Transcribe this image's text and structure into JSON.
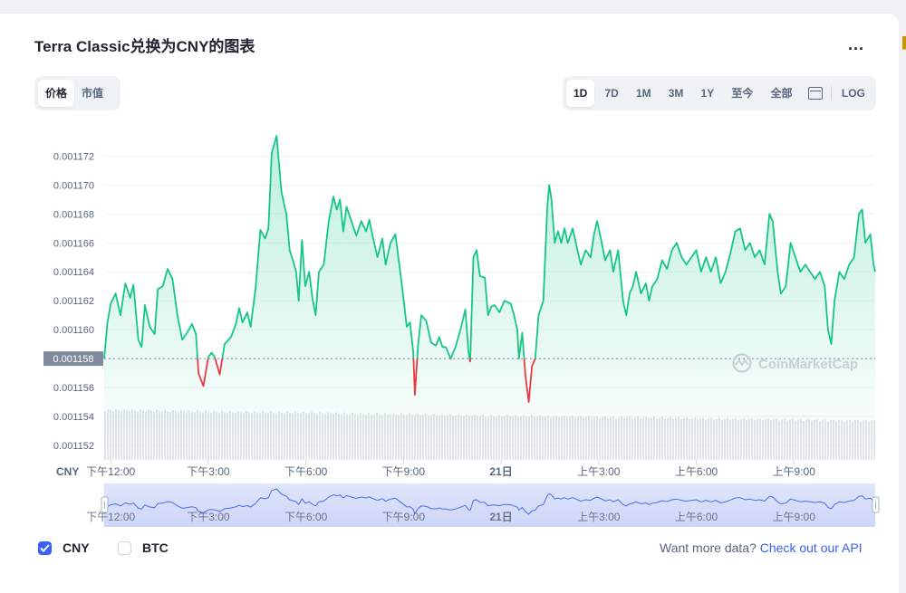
{
  "header": {
    "title": "Terra Classic兑换为CNY的图表",
    "more": "..."
  },
  "view_tabs": [
    {
      "label": "价格",
      "active": true
    },
    {
      "label": "市值",
      "active": false
    }
  ],
  "range_tabs": [
    {
      "label": "1D",
      "active": true
    },
    {
      "label": "7D"
    },
    {
      "label": "1M"
    },
    {
      "label": "3M"
    },
    {
      "label": "1Y"
    },
    {
      "label": "至今"
    },
    {
      "label": "全部"
    }
  ],
  "log_label": "LOG",
  "colors": {
    "up": "#16c784",
    "down": "#ea3943",
    "accent": "#3861fb",
    "volume": "#e6e7ea",
    "navigator": "#e8ecfb"
  },
  "watermark": "CoinMarketCap",
  "legend": [
    {
      "label": "CNY",
      "checked": true
    },
    {
      "label": "BTC",
      "checked": false
    }
  ],
  "footer": {
    "text": "Want more data?",
    "link": "Check out our API"
  },
  "chart_data": {
    "type": "area",
    "currency_label": "CNY",
    "y_ticks": [
      0.001152,
      0.001154,
      0.001156,
      0.001158,
      0.00116,
      0.001162,
      0.001164,
      0.001166,
      0.001168,
      0.00117,
      0.001172
    ],
    "ylim": [
      0.001151,
      0.0011734
    ],
    "reference_value": 0.001158,
    "reference_label": "0.001158",
    "x_ticks": [
      "下午12:00",
      "下午3:00",
      "下午6:00",
      "下午9:00",
      "21日",
      "上午3:00",
      "上午6:00",
      "上午9:00"
    ],
    "x_tick_hours": [
      12,
      15,
      18,
      21,
      24,
      27,
      30,
      33
    ],
    "xlim": [
      11.8,
      35.5
    ],
    "grid": true,
    "series": [
      {
        "values": [
          [
            11.8,
            0.001158
          ],
          [
            11.9,
            0.0011605
          ],
          [
            12.0,
            0.0011618
          ],
          [
            12.15,
            0.0011625
          ],
          [
            12.3,
            0.001161
          ],
          [
            12.45,
            0.0011632
          ],
          [
            12.6,
            0.0011622
          ],
          [
            12.7,
            0.0011631
          ],
          [
            12.85,
            0.0011593
          ],
          [
            12.95,
            0.0011588
          ],
          [
            13.05,
            0.0011617
          ],
          [
            13.2,
            0.0011602
          ],
          [
            13.35,
            0.0011597
          ],
          [
            13.45,
            0.0011628
          ],
          [
            13.6,
            0.001163
          ],
          [
            13.75,
            0.0011642
          ],
          [
            13.9,
            0.0011635
          ],
          [
            14.05,
            0.001161
          ],
          [
            14.2,
            0.0011593
          ],
          [
            14.35,
            0.0011598
          ],
          [
            14.5,
            0.0011604
          ],
          [
            14.62,
            0.0011597
          ],
          [
            14.7,
            0.001157
          ],
          [
            14.85,
            0.0011561
          ],
          [
            15.0,
            0.0011581
          ],
          [
            15.1,
            0.0011584
          ],
          [
            15.2,
            0.0011581
          ],
          [
            15.35,
            0.0011569
          ],
          [
            15.5,
            0.001159
          ],
          [
            15.7,
            0.0011595
          ],
          [
            15.85,
            0.0011604
          ],
          [
            15.95,
            0.0011615
          ],
          [
            16.05,
            0.0011605
          ],
          [
            16.2,
            0.0011612
          ],
          [
            16.3,
            0.0011602
          ],
          [
            16.45,
            0.0011628
          ],
          [
            16.6,
            0.0011669
          ],
          [
            16.75,
            0.0011663
          ],
          [
            16.85,
            0.001167
          ],
          [
            16.95,
            0.0011722
          ],
          [
            17.1,
            0.0011734
          ],
          [
            17.25,
            0.0011695
          ],
          [
            17.4,
            0.001168
          ],
          [
            17.5,
            0.0011655
          ],
          [
            17.6,
            0.0011648
          ],
          [
            17.7,
            0.001164
          ],
          [
            17.78,
            0.001162
          ],
          [
            17.88,
            0.0011662
          ],
          [
            17.98,
            0.001163
          ],
          [
            18.1,
            0.001164
          ],
          [
            18.2,
            0.0011622
          ],
          [
            18.3,
            0.001161
          ],
          [
            18.4,
            0.001164
          ],
          [
            18.55,
            0.0011645
          ],
          [
            18.7,
            0.0011675
          ],
          [
            18.85,
            0.0011692
          ],
          [
            18.95,
            0.0011683
          ],
          [
            19.05,
            0.001169
          ],
          [
            19.15,
            0.0011668
          ],
          [
            19.25,
            0.0011685
          ],
          [
            19.4,
            0.0011675
          ],
          [
            19.55,
            0.0011665
          ],
          [
            19.7,
            0.0011675
          ],
          [
            19.85,
            0.0011668
          ],
          [
            19.95,
            0.0011676
          ],
          [
            20.05,
            0.0011665
          ],
          [
            20.2,
            0.001165
          ],
          [
            20.35,
            0.0011663
          ],
          [
            20.45,
            0.0011645
          ],
          [
            20.6,
            0.001166
          ],
          [
            20.75,
            0.0011666
          ],
          [
            20.9,
            0.001164
          ],
          [
            21.0,
            0.0011622
          ],
          [
            21.1,
            0.0011602
          ],
          [
            21.2,
            0.0011605
          ],
          [
            21.3,
            0.0011585
          ],
          [
            21.35,
            0.0011555
          ],
          [
            21.45,
            0.001159
          ],
          [
            21.55,
            0.001161
          ],
          [
            21.7,
            0.0011606
          ],
          [
            21.85,
            0.0011591
          ],
          [
            22.0,
            0.0011589
          ],
          [
            22.1,
            0.0011595
          ],
          [
            22.2,
            0.0011588
          ],
          [
            22.3,
            0.0011588
          ],
          [
            22.45,
            0.001158
          ],
          [
            22.6,
            0.0011588
          ],
          [
            22.75,
            0.00116
          ],
          [
            22.9,
            0.0011614
          ],
          [
            23.0,
            0.0011584
          ],
          [
            23.05,
            0.0011578
          ],
          [
            23.15,
            0.001165
          ],
          [
            23.25,
            0.0011655
          ],
          [
            23.35,
            0.0011637
          ],
          [
            23.5,
            0.0011636
          ],
          [
            23.6,
            0.001161
          ],
          [
            23.7,
            0.0011616
          ],
          [
            23.8,
            0.0011617
          ],
          [
            23.95,
            0.0011612
          ],
          [
            24.1,
            0.001162
          ],
          [
            24.3,
            0.0011618
          ],
          [
            24.4,
            0.001161
          ],
          [
            24.5,
            0.00116
          ],
          [
            24.55,
            0.001158
          ],
          [
            24.65,
            0.0011598
          ],
          [
            24.75,
            0.0011568
          ],
          [
            24.85,
            0.001155
          ],
          [
            24.95,
            0.0011575
          ],
          [
            25.05,
            0.001158
          ],
          [
            25.15,
            0.001161
          ],
          [
            25.3,
            0.001162
          ],
          [
            25.42,
            0.0011685
          ],
          [
            25.48,
            0.00117
          ],
          [
            25.55,
            0.001169
          ],
          [
            25.65,
            0.001166
          ],
          [
            25.75,
            0.0011668
          ],
          [
            25.85,
            0.001166
          ],
          [
            25.95,
            0.001167
          ],
          [
            26.05,
            0.001166
          ],
          [
            26.2,
            0.001167
          ],
          [
            26.35,
            0.0011655
          ],
          [
            26.45,
            0.0011645
          ],
          [
            26.6,
            0.0011655
          ],
          [
            26.75,
            0.001165
          ],
          [
            26.85,
            0.0011665
          ],
          [
            26.95,
            0.0011675
          ],
          [
            27.05,
            0.0011665
          ],
          [
            27.2,
            0.0011648
          ],
          [
            27.35,
            0.0011655
          ],
          [
            27.45,
            0.001164
          ],
          [
            27.6,
            0.0011655
          ],
          [
            27.75,
            0.001162
          ],
          [
            27.85,
            0.001161
          ],
          [
            27.95,
            0.0011625
          ],
          [
            28.05,
            0.001163
          ],
          [
            28.15,
            0.001164
          ],
          [
            28.3,
            0.0011625
          ],
          [
            28.45,
            0.0011632
          ],
          [
            28.55,
            0.001162
          ],
          [
            28.65,
            0.001163
          ],
          [
            28.8,
            0.0011635
          ],
          [
            28.95,
            0.0011648
          ],
          [
            29.1,
            0.0011642
          ],
          [
            29.25,
            0.0011655
          ],
          [
            29.4,
            0.001166
          ],
          [
            29.55,
            0.001165
          ],
          [
            29.7,
            0.0011645
          ],
          [
            29.85,
            0.001165
          ],
          [
            30.0,
            0.0011655
          ],
          [
            30.15,
            0.001164
          ],
          [
            30.3,
            0.001165
          ],
          [
            30.45,
            0.001164
          ],
          [
            30.6,
            0.001165
          ],
          [
            30.75,
            0.0011632
          ],
          [
            30.9,
            0.001164
          ],
          [
            31.05,
            0.0011653
          ],
          [
            31.2,
            0.0011668
          ],
          [
            31.35,
            0.001167
          ],
          [
            31.5,
            0.0011655
          ],
          [
            31.65,
            0.001166
          ],
          [
            31.8,
            0.001165
          ],
          [
            31.95,
            0.0011655
          ],
          [
            32.1,
            0.0011645
          ],
          [
            32.25,
            0.001168
          ],
          [
            32.35,
            0.0011675
          ],
          [
            32.5,
            0.001164
          ],
          [
            32.6,
            0.0011625
          ],
          [
            32.75,
            0.001163
          ],
          [
            32.9,
            0.001166
          ],
          [
            33.05,
            0.001165
          ],
          [
            33.2,
            0.001164
          ],
          [
            33.35,
            0.0011645
          ],
          [
            33.5,
            0.001164
          ],
          [
            33.65,
            0.0011635
          ],
          [
            33.8,
            0.001164
          ],
          [
            33.95,
            0.001163
          ],
          [
            34.05,
            0.00116
          ],
          [
            34.15,
            0.001159
          ],
          [
            34.25,
            0.001162
          ],
          [
            34.4,
            0.001164
          ],
          [
            34.55,
            0.0011635
          ],
          [
            34.7,
            0.0011645
          ],
          [
            34.85,
            0.001165
          ],
          [
            35.0,
            0.001168
          ],
          [
            35.1,
            0.0011683
          ],
          [
            35.2,
            0.001166
          ],
          [
            35.35,
            0.0011666
          ],
          [
            35.45,
            0.0011645
          ],
          [
            35.5,
            0.001164
          ]
        ]
      }
    ]
  }
}
